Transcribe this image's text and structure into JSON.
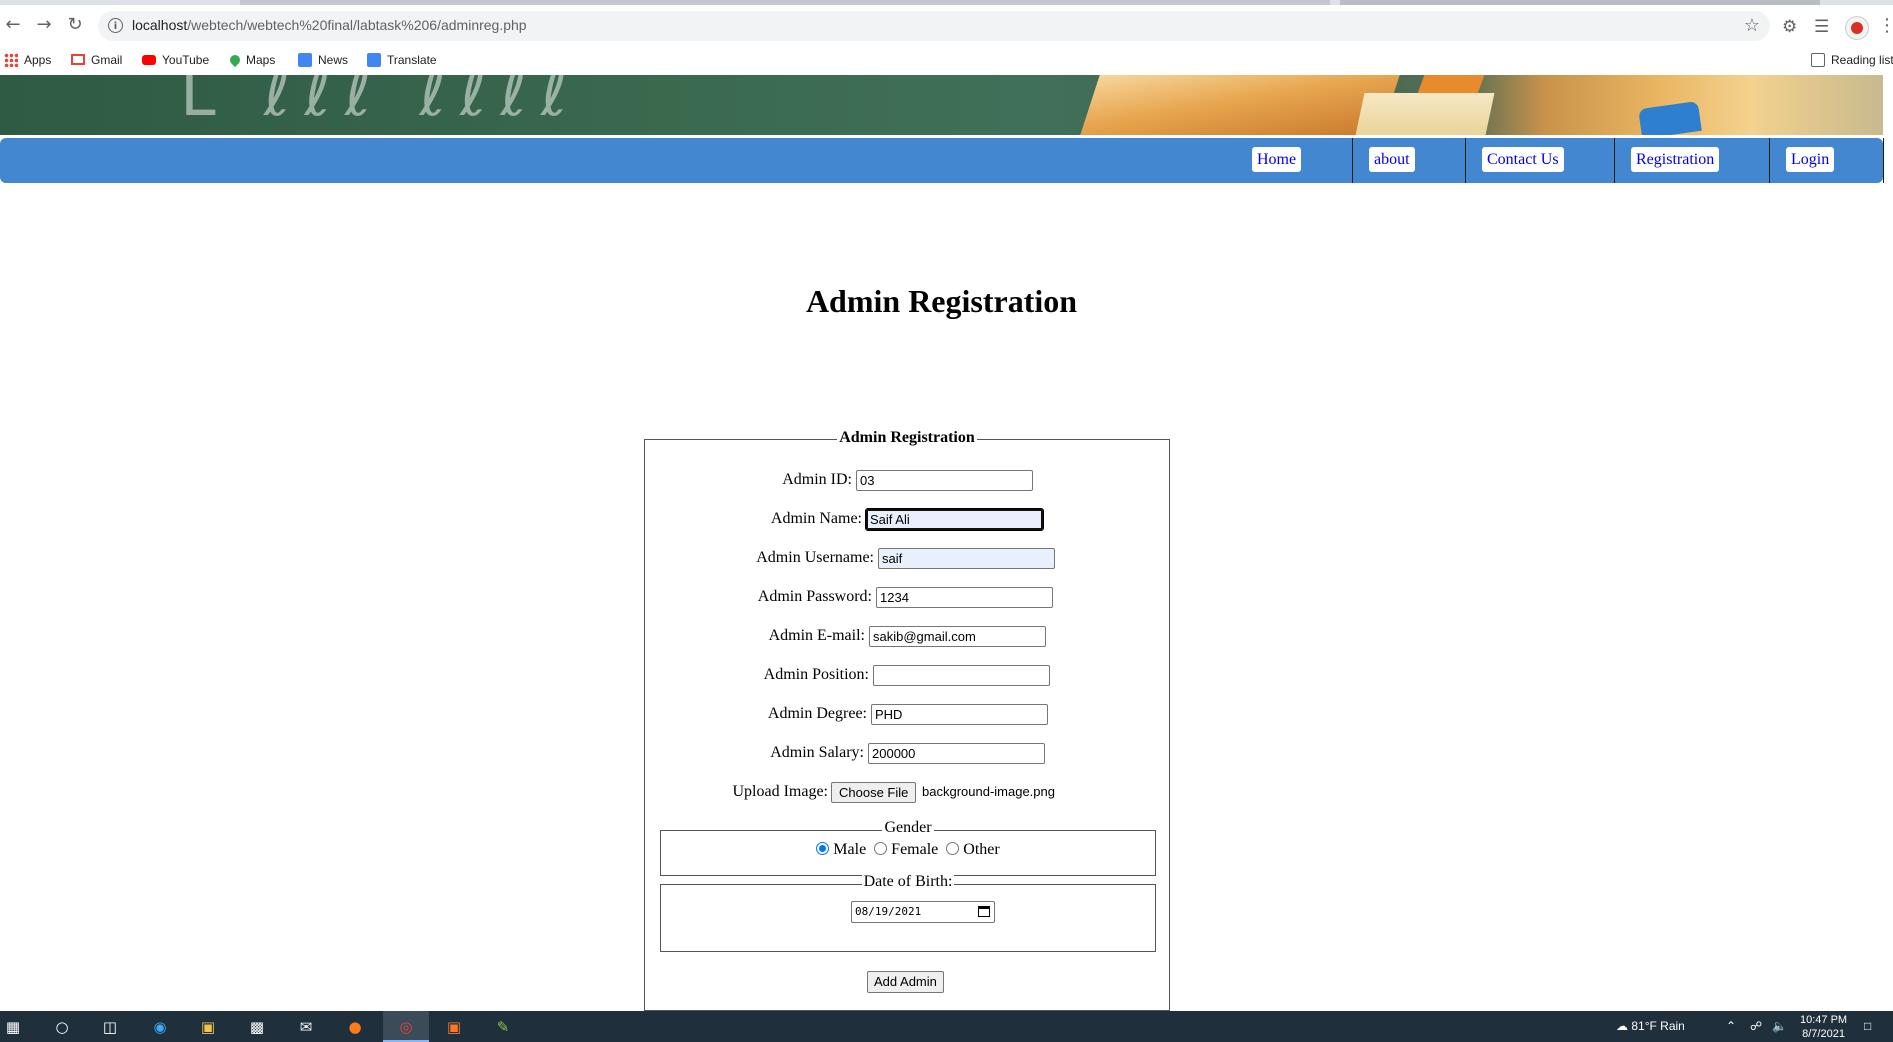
{
  "browser": {
    "url_host": "localhost",
    "url_path": "/webtech/webtech%20final/labtask%206/adminreg.php",
    "bookmarks": [
      {
        "label": "Apps",
        "icon": "apps-icon"
      },
      {
        "label": "Gmail",
        "icon": "gmail-icon"
      },
      {
        "label": "YouTube",
        "icon": "youtube-icon"
      },
      {
        "label": "Maps",
        "icon": "maps-icon"
      },
      {
        "label": "News",
        "icon": "news-icon"
      },
      {
        "label": "Translate",
        "icon": "translate-icon"
      }
    ],
    "reading_list": "Reading list"
  },
  "nav": {
    "items": [
      "Home",
      "about",
      "Contact Us",
      "Registration",
      "Login"
    ]
  },
  "page": {
    "title": "Admin Registration"
  },
  "form": {
    "legend": "Admin Registration",
    "fields": {
      "id": {
        "label": "Admin ID:",
        "value": "03"
      },
      "name": {
        "label": "Admin Name:",
        "value": "Saif Ali"
      },
      "username": {
        "label": "Admin Username:",
        "value": "saif"
      },
      "password": {
        "label": "Admin Password:",
        "value": "1234"
      },
      "email": {
        "label": "Admin E-mail:",
        "value": "sakib@gmail.com"
      },
      "position": {
        "label": "Admin Position:",
        "value": ""
      },
      "degree": {
        "label": "Admin Degree:",
        "value": "PHD"
      },
      "salary": {
        "label": "Admin Salary:",
        "value": "200000"
      }
    },
    "upload": {
      "label": "Upload Image:",
      "button": "Choose File",
      "filename": "background-image.png"
    },
    "gender": {
      "legend": "Gender",
      "options": [
        "Male",
        "Female",
        "Other"
      ],
      "selected": "Male"
    },
    "dob": {
      "legend": "Date of Birth:",
      "value": "08/19/2021"
    },
    "submit": "Add Admin"
  },
  "taskbar": {
    "weather": "81°F  Rain",
    "time": "10:47 PM",
    "date": "8/7/2021"
  },
  "colors": {
    "navbar": "#4287cf",
    "link": "#0000ee",
    "radio_accent": "#0075ff"
  }
}
